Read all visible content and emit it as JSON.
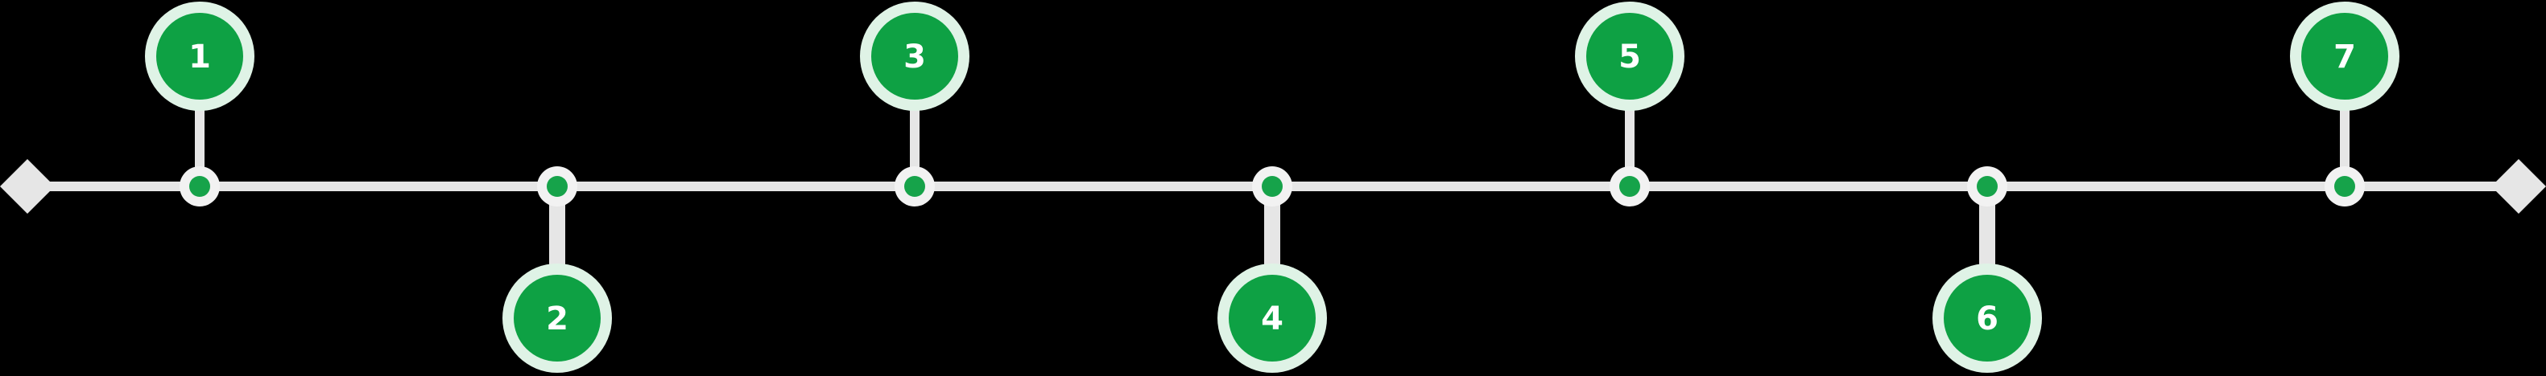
{
  "timeline": {
    "steps": [
      {
        "number": "1",
        "side": "top"
      },
      {
        "number": "2",
        "side": "bottom"
      },
      {
        "number": "3",
        "side": "top"
      },
      {
        "number": "4",
        "side": "bottom"
      },
      {
        "number": "5",
        "side": "top"
      },
      {
        "number": "6",
        "side": "bottom"
      },
      {
        "number": "7",
        "side": "top"
      }
    ],
    "colors": {
      "background": "#000000",
      "track": "#e6e6e6",
      "node_outer": "#f2f2f2",
      "node_inner": "#16a34a",
      "badge_halo": "#dff3e6",
      "badge_fill": "#0ea144",
      "badge_text": "#ffffff",
      "end_cap": "#e6e6e6"
    }
  }
}
